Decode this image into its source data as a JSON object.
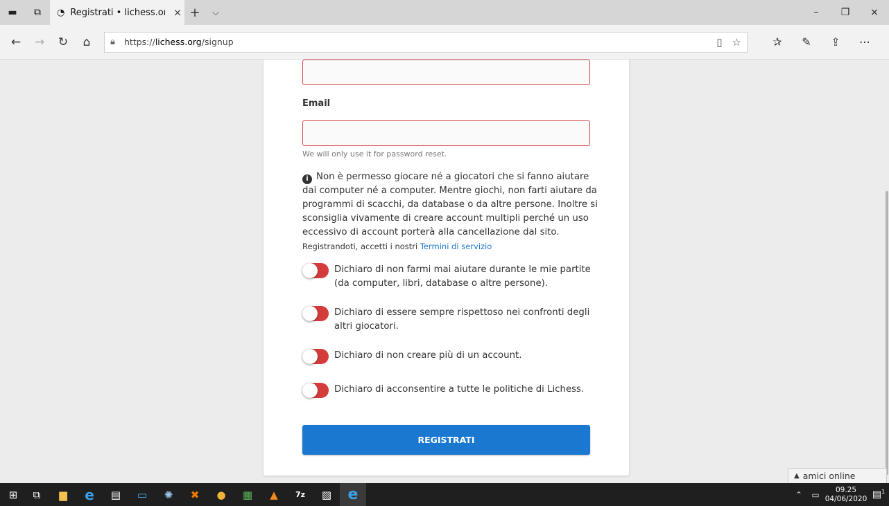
{
  "browser": {
    "tab_title": "Registrati • lichess.org",
    "tab_close": "×",
    "new_tab": "+",
    "tab_list": "⌵",
    "url_prefix": "https://",
    "url_host": "lichess.org",
    "url_path": "/signup",
    "window_minimize": "–",
    "window_restore": "❐",
    "window_close": "×"
  },
  "form": {
    "email_label": "Email",
    "email_hint": "We will only use it for password reset.",
    "info_icon": "i",
    "info_text": "Non è permesso giocare né a giocatori che si fanno aiutare dai computer né a computer. Mentre giochi, non farti aiutare da programmi di scacchi, da database o da altre persone. Inoltre si sconsiglia vivamente di creare account multipli perché un uso eccessivo di account porterà alla cancellazione dal sito.",
    "terms_prefix": "Registrandoti, accetti i nostri ",
    "terms_link": "Termini di servizio",
    "agreements": [
      {
        "label": "Dichiaro di non farmi mai aiutare durante le mie partite (da computer, libri, database o altre persone)."
      },
      {
        "label": "Dichiaro di essere sempre rispettoso nei confronti degli altri giocatori."
      },
      {
        "label": "Dichiaro di non creare più di un account."
      },
      {
        "label": "Dichiaro di acconsentire a tutte le politiche di Lichess."
      }
    ],
    "submit_label": "REGISTRATI",
    "toggle_color": "#d43c3c",
    "accent_color": "#1b78d0"
  },
  "friends_bar": {
    "arrow": "▲",
    "label": "amici online"
  },
  "taskbar": {
    "time": "09.25",
    "date": "04/06/2020",
    "notification_count": "1"
  }
}
